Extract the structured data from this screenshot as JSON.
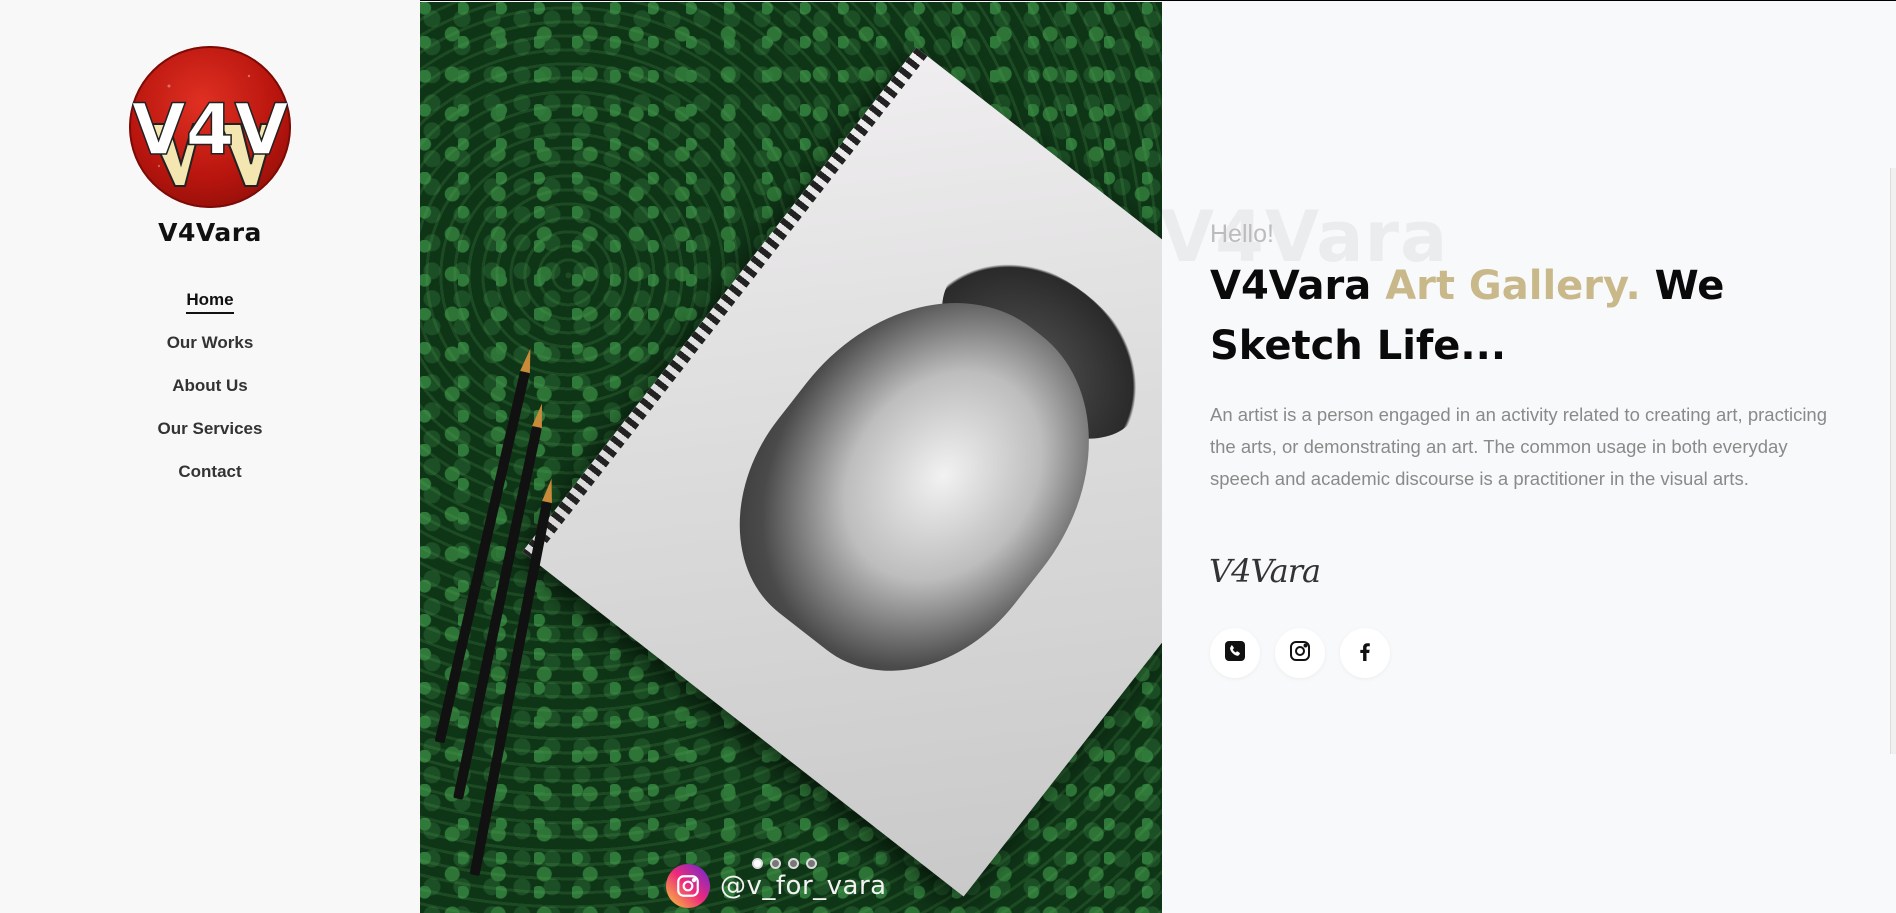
{
  "sidebar": {
    "brand": "V4Vara",
    "logo_text": "V4V",
    "nav": [
      {
        "label": "Home",
        "active": true
      },
      {
        "label": "Our Works",
        "active": false
      },
      {
        "label": "About Us",
        "active": false
      },
      {
        "label": "Our Services",
        "active": false
      },
      {
        "label": "Contact",
        "active": false
      }
    ]
  },
  "hero": {
    "instagram_handle": "@v_for_vara",
    "slides": 4,
    "active_slide": 1
  },
  "content": {
    "background_word": "V4Vara",
    "greeting": "Hello!",
    "headline_part1": "V4Vara ",
    "headline_highlight": "Art Gallery.",
    "headline_part2": " We Sketch Life...",
    "description": "An artist is a person engaged in an activity related to creating art, practicing the arts, or demonstrating an art. The common usage in both everyday speech and academic discourse is a practitioner in the visual arts.",
    "signature": "V4Vara",
    "socials": [
      {
        "icon": "phone-icon"
      },
      {
        "icon": "instagram-icon"
      },
      {
        "icon": "facebook-icon"
      }
    ]
  },
  "colors": {
    "accent_gold": "#c9b98a",
    "text_dark": "#0a0a0a",
    "text_muted": "#8a8a8a",
    "logo_red": "#b8150e"
  }
}
